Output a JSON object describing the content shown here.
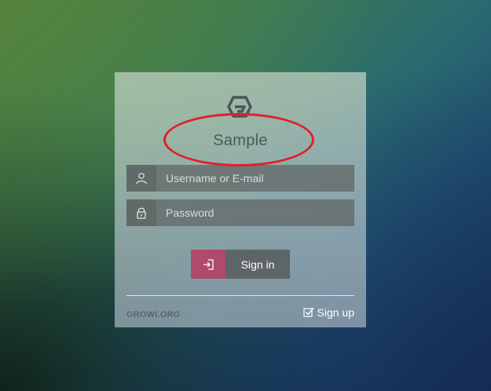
{
  "brand": {
    "name": "Sample"
  },
  "login_form": {
    "username_placeholder": "Username or E-mail",
    "password_placeholder": "Password",
    "signin_label": "Sign in"
  },
  "footer": {
    "site_link": "GROWI.ORG",
    "signup_label": "Sign up"
  },
  "icons": {
    "logo": "growi-logo-icon",
    "username": "user-icon",
    "password": "lock-icon",
    "signin": "sign-in-icon",
    "signup": "checkbox-icon"
  },
  "colors": {
    "signin_accent": "#b04a6a",
    "annotation": "#e0202c"
  }
}
